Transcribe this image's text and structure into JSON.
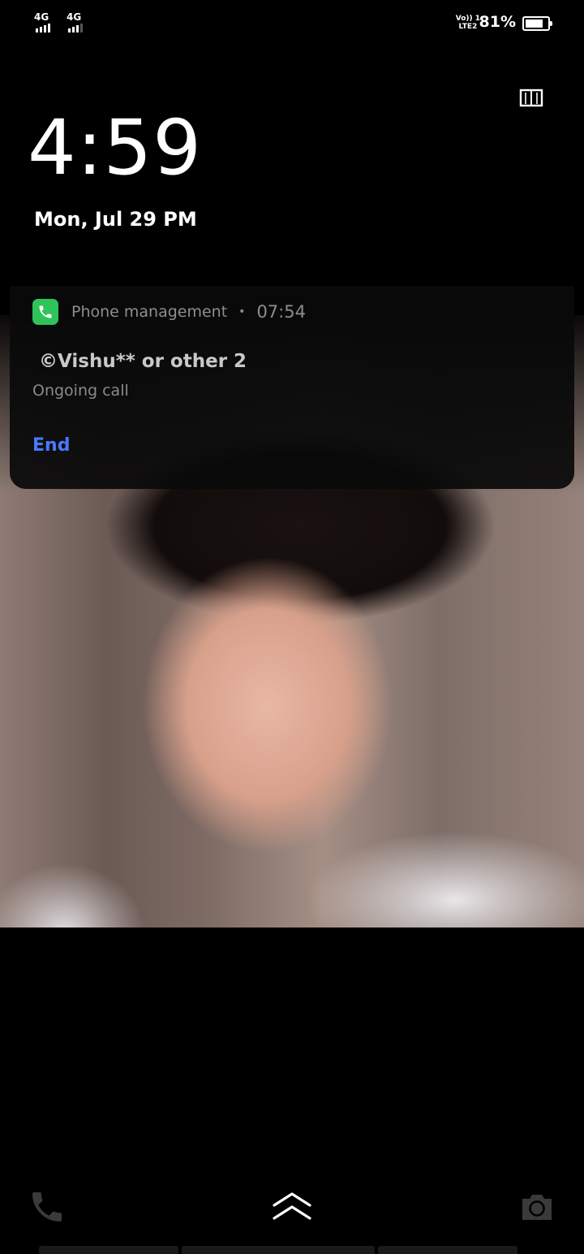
{
  "status_bar": {
    "sim1_network": "4G",
    "sim2_network": "4G",
    "volte_line1": "Vo)) 1",
    "volte_line2": "LTE2",
    "battery_percent": "81%",
    "battery_level": 0.81
  },
  "lockscreen": {
    "time": "4:59",
    "date": "Mon, Jul 29  PM"
  },
  "notification": {
    "app_name": "Phone management",
    "separator": "•",
    "time": "07:54",
    "title": "©Vishu** or other 2",
    "subtitle": "Ongoing call",
    "action_end": "End",
    "app_icon": "phone-icon",
    "app_icon_color": "#2fc45a",
    "action_color": "#4a78ff"
  },
  "bottom": {
    "left_icon": "phone-icon",
    "center_icon": "chevron-up-icon",
    "right_icon": "camera-icon"
  }
}
